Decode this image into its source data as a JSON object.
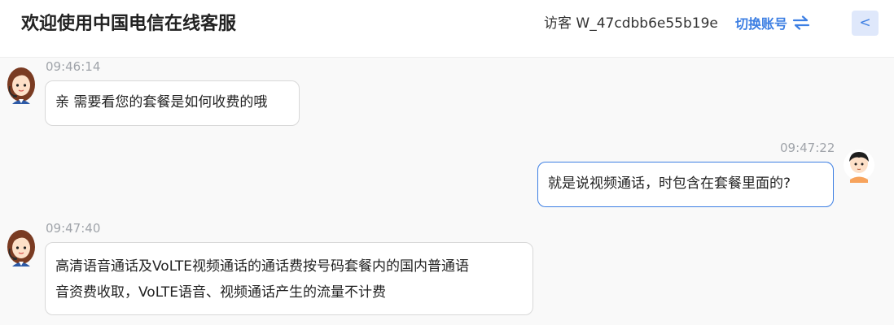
{
  "header": {
    "title": "欢迎使用中国电信在线客服",
    "visitor_label": "访客 W_47cdbb6e55b19e",
    "switch_account_label": "切换账号",
    "back_label": "<"
  },
  "colors": {
    "accent": "#3d7fe3",
    "chat_background": "#f9f9f9",
    "timestamp": "#a0a4aa"
  },
  "messages": [
    {
      "sender": "agent",
      "time": "09:46:14",
      "text": "亲 需要看您的套餐是如何收费的哦"
    },
    {
      "sender": "user",
      "time": "09:47:22",
      "text": "就是说视频通话，时包含在套餐里面的?"
    },
    {
      "sender": "agent",
      "time": "09:47:40",
      "lines": [
        "高清语音通话及VoLTE视频通话的通话费按号码套餐内的国内普通语",
        "音资费收取，VoLTE语音、视频通话产生的流量不计费"
      ]
    }
  ],
  "icons": {
    "agent_avatar": "agent-avatar-icon",
    "user_avatar": "user-avatar-icon",
    "switch": "swap-arrows-icon"
  }
}
